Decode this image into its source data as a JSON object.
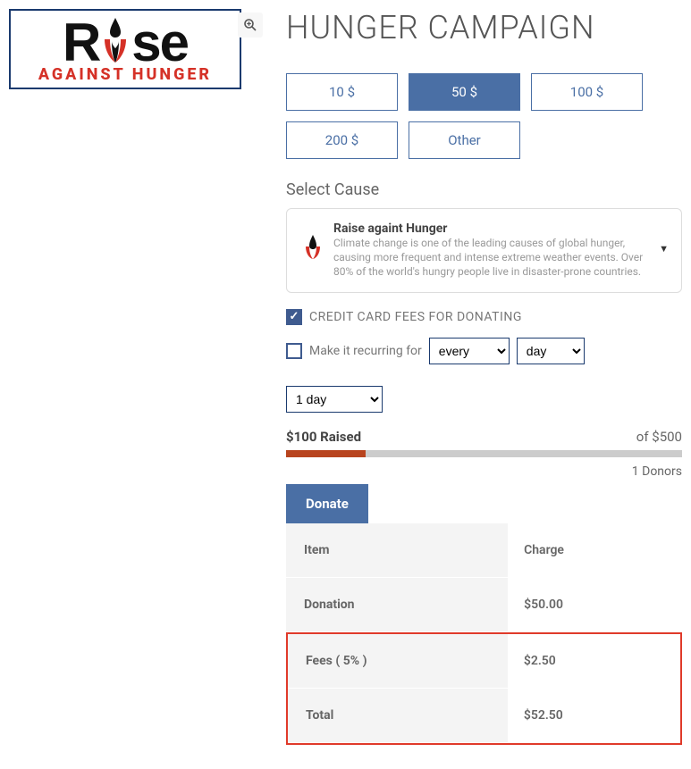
{
  "logo": {
    "rise": "R  se",
    "tagline": "AGAINST HUNGER"
  },
  "title": "HUNGER CAMPAIGN",
  "amounts": [
    {
      "label": "10 $",
      "active": false
    },
    {
      "label": "50 $",
      "active": true
    },
    {
      "label": "100 $",
      "active": false
    },
    {
      "label": "200 $",
      "active": false
    },
    {
      "label": "Other",
      "active": false
    }
  ],
  "select_cause_label": "Select Cause",
  "cause": {
    "title": "Raise againt Hunger",
    "desc": "Climate change is one of the leading causes of global hunger, causing more frequent and intense extreme weather events. Over 80% of the world's hungry people live in disaster-prone countries."
  },
  "cc_fees_label": "CREDIT CARD FEES FOR DONATING",
  "recurring": {
    "label": "Make it recurring for",
    "every": "every",
    "day": "day",
    "one_day": "1 day"
  },
  "progress": {
    "raised": "$100 Raised",
    "of": "of $500",
    "percent": 20,
    "donors": "1 Donors"
  },
  "donate_label": "Donate",
  "table": {
    "h_item": "Item",
    "h_charge": "Charge",
    "donation_label": "Donation",
    "donation_value": "$50.00",
    "fees_label": "Fees ( 5% )",
    "fees_value": "$2.50",
    "total_label": "Total",
    "total_value": "$52.50"
  }
}
